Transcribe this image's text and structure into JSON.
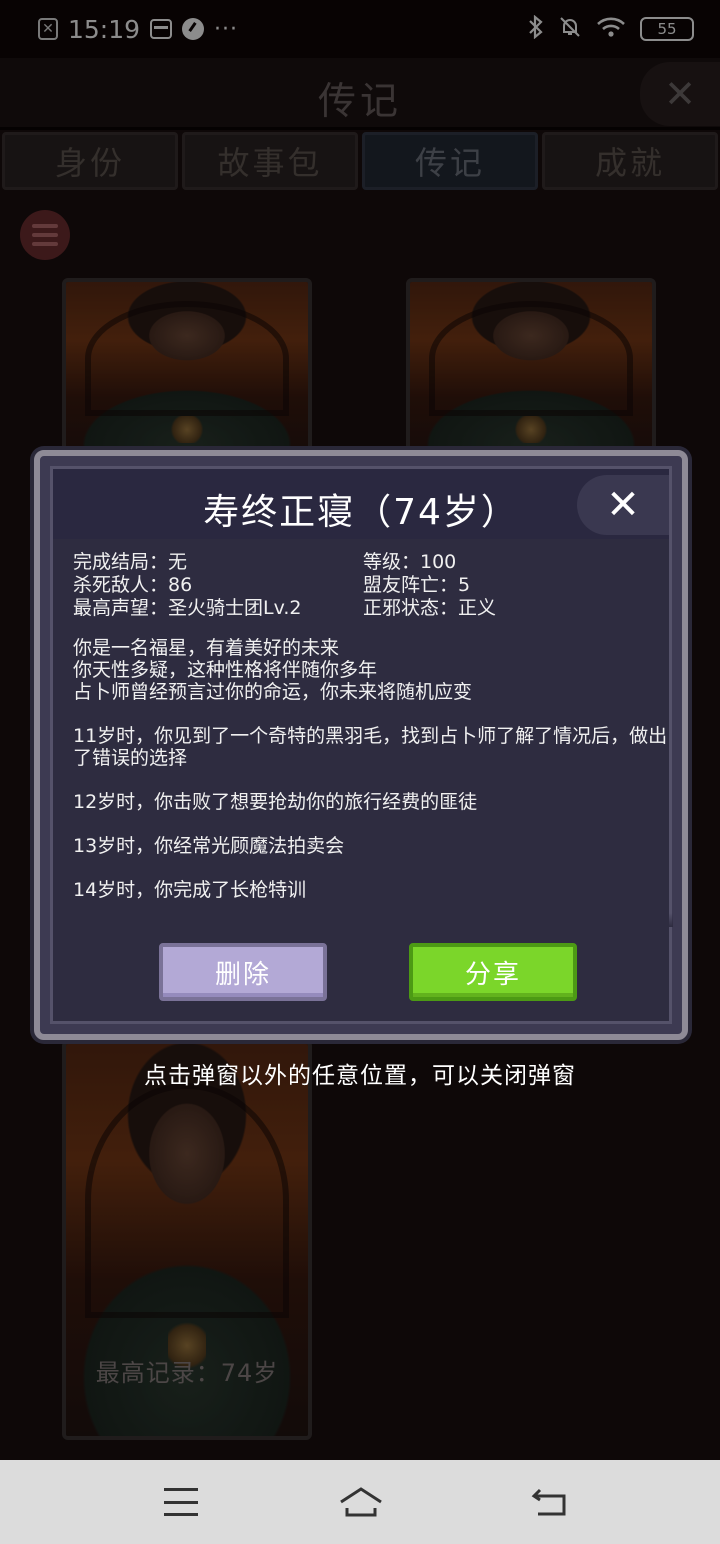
{
  "status": {
    "time": "15:19",
    "dots": "···",
    "battery": "55"
  },
  "header": {
    "title": "传记",
    "close": "✕"
  },
  "tabs": [
    {
      "label": "身份"
    },
    {
      "label": "故事包"
    },
    {
      "label": "传记",
      "active": true
    },
    {
      "label": "成就"
    }
  ],
  "cards": {
    "best_record": "最高记录：74岁"
  },
  "modal": {
    "title": "寿终正寝（74岁）",
    "close": "✕",
    "stats": [
      {
        "text": "完成结局：无"
      },
      {
        "text": "等级：100"
      },
      {
        "text": "杀死敌人：86"
      },
      {
        "text": "盟友阵亡：5"
      },
      {
        "text": "最高声望：圣火骑士团Lv.2"
      },
      {
        "text": "正邪状态：正义"
      }
    ],
    "story": [
      "你是一名福星，有着美好的未来\n你天性多疑，这种性格将伴随你多年\n占卜师曾经预言过你的命运，你未来将随机应变",
      "11岁时，你见到了一个奇特的黑羽毛，找到占卜师了解了情况后，做出了错误的选择",
      "12岁时，你击败了想要抢劫你的旅行经费的匪徒",
      "13岁时，你经常光顾魔法拍卖会",
      "14岁时，你完成了长枪特训"
    ],
    "delete_label": "删除",
    "share_label": "分享"
  },
  "hint": "点击弹窗以外的任意位置，可以关闭弹窗",
  "colors": {
    "share_green": "#7bd62a",
    "delete_purple": "#b3a9d6",
    "modal_bg": "#2e2c40"
  }
}
